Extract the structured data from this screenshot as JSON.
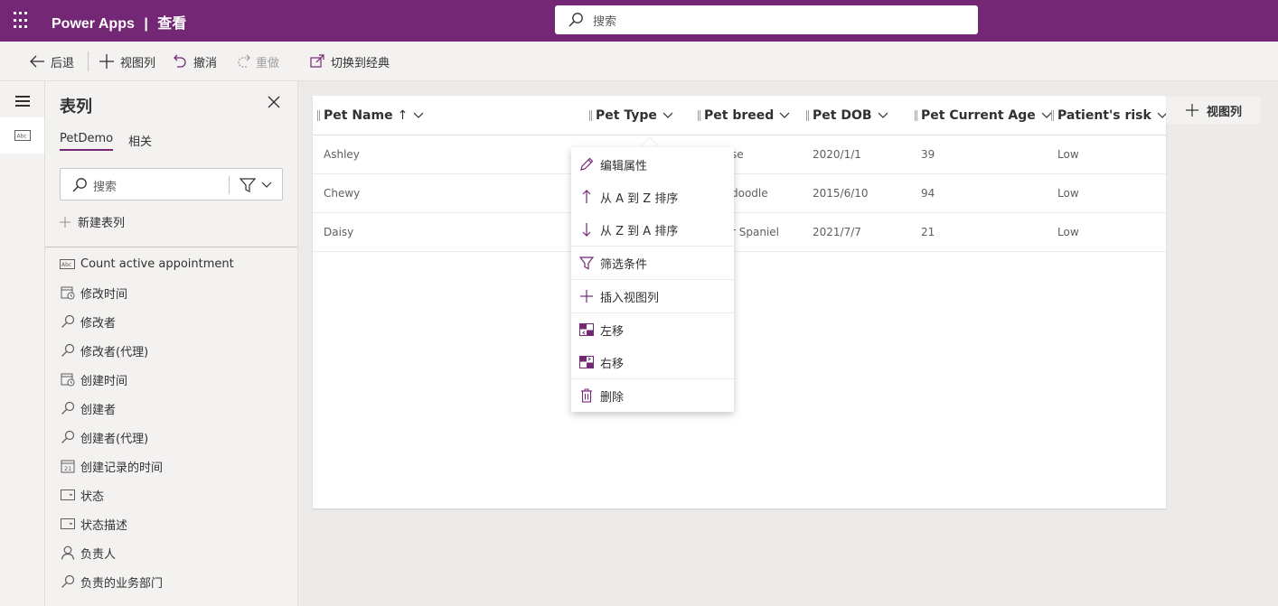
{
  "topbar": {
    "app_name": "Power Apps",
    "separator": "|",
    "page_name": "查看",
    "search_placeholder": "搜索"
  },
  "commandbar": {
    "back": "后退",
    "add_view_column": "视图列",
    "undo": "撤消",
    "redo": "重做",
    "switch_classic": "切换到经典"
  },
  "pane": {
    "title": "表列",
    "tabs": [
      "PetDemo",
      "相关"
    ],
    "search_placeholder": "搜索",
    "new_column": "新建表列",
    "fields": [
      {
        "label": "Count active appointment",
        "icon": "text-field-icon"
      },
      {
        "label": "修改时间",
        "icon": "datetime-icon"
      },
      {
        "label": "修改者",
        "icon": "lookup-icon"
      },
      {
        "label": "修改者(代理)",
        "icon": "lookup-icon"
      },
      {
        "label": "创建时间",
        "icon": "datetime-icon"
      },
      {
        "label": "创建者",
        "icon": "lookup-icon"
      },
      {
        "label": "创建者(代理)",
        "icon": "lookup-icon"
      },
      {
        "label": "创建记录的时间",
        "icon": "calendar-icon"
      },
      {
        "label": "状态",
        "icon": "choice-icon"
      },
      {
        "label": "状态描述",
        "icon": "choice-icon"
      },
      {
        "label": "负责人",
        "icon": "person-icon"
      },
      {
        "label": "负责的业务部门",
        "icon": "lookup-icon"
      }
    ]
  },
  "grid": {
    "columns": [
      {
        "label": "Pet Name",
        "sort": "↑"
      },
      {
        "label": "Pet Type"
      },
      {
        "label": "Pet breed"
      },
      {
        "label": "Pet DOB"
      },
      {
        "label": "Pet Current Age"
      },
      {
        "label": "Patient's risk"
      }
    ],
    "rows": [
      {
        "name": "Ashley",
        "breed": "se",
        "dob": "2020/1/1",
        "age": "39",
        "risk": "Low"
      },
      {
        "name": "Chewy",
        "breed": "doodle",
        "dob": "2015/6/10",
        "age": "94",
        "risk": "Low"
      },
      {
        "name": "Daisy",
        "breed": "r Spaniel",
        "dob": "2021/7/7",
        "age": "21",
        "risk": "Low"
      }
    ],
    "add_view_column": "视图列"
  },
  "context_menu": {
    "items": [
      {
        "label": "编辑属性",
        "icon": "pencil-icon"
      },
      {
        "label": "从 A 到 Z 排序",
        "icon": "arrow-up-icon"
      },
      {
        "label": "从 Z 到 A 排序",
        "icon": "arrow-down-icon"
      },
      {
        "label": "筛选条件",
        "icon": "filter-icon"
      },
      {
        "label": "插入视图列",
        "icon": "plus-icon"
      },
      {
        "label": "左移",
        "icon": "move-left-icon"
      },
      {
        "label": "右移",
        "icon": "move-right-icon"
      },
      {
        "label": "删除",
        "icon": "trash-icon"
      }
    ]
  },
  "colors": {
    "brand": "#742774",
    "pane_bg": "#f3f2f1",
    "canvas_bg": "#edebe9"
  }
}
